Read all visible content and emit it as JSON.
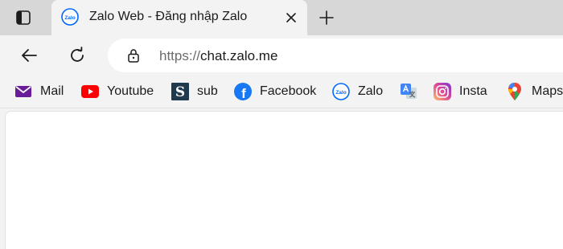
{
  "tab": {
    "title": "Zalo Web - Đăng nhập Zalo",
    "favicon_text": "Zalo"
  },
  "toolbar": {
    "url_scheme": "https://",
    "url_host": "chat.zalo.me"
  },
  "bookmarks": [
    {
      "label": "Mail",
      "icon": "mail-icon",
      "color": "#6a1b9a"
    },
    {
      "label": "Youtube",
      "icon": "youtube-icon",
      "color": "#ff0000"
    },
    {
      "label": "sub",
      "icon": "s-logo-icon",
      "color": "#1f3a4d",
      "glyph": "S"
    },
    {
      "label": "Facebook",
      "icon": "facebook-icon",
      "color": "#1877f2",
      "glyph": "f"
    },
    {
      "label": "Zalo",
      "icon": "zalo-icon",
      "color": "#0068ff",
      "glyph": "Zalo"
    },
    {
      "label": "",
      "icon": "google-translate-icon",
      "color": "#4285f4"
    },
    {
      "label": "Insta",
      "icon": "instagram-icon",
      "color": "#d6249f"
    },
    {
      "label": "Maps",
      "icon": "google-maps-icon",
      "color": "#ea4335"
    }
  ]
}
